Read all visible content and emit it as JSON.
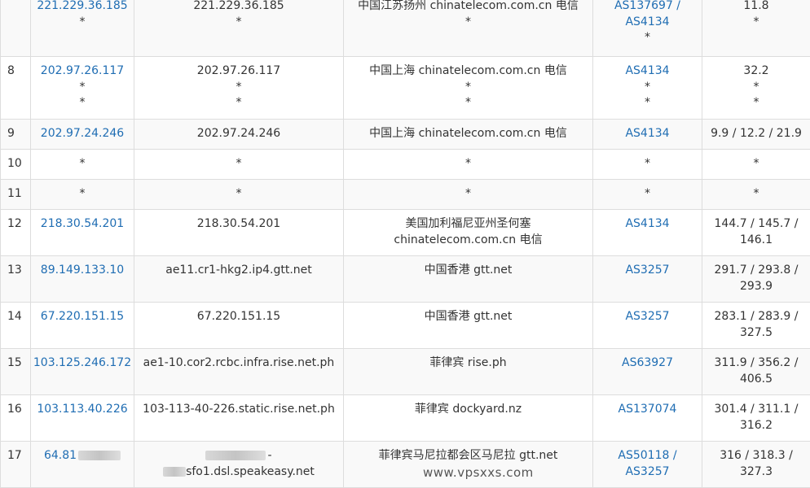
{
  "rows": [
    {
      "hop": "",
      "ip": [
        "221.229.36.185",
        "*"
      ],
      "host": [
        "221.229.36.185",
        "*"
      ],
      "loc": [
        "中国江苏扬州 chinatelecom.com.cn 电信",
        "*"
      ],
      "asn": [
        "AS137697 /",
        "AS4134",
        "*"
      ],
      "time": [
        "11.8",
        "*"
      ]
    },
    {
      "hop": "8",
      "ip": [
        "202.97.26.117",
        "*",
        "*"
      ],
      "host": [
        "202.97.26.117",
        "*",
        "*"
      ],
      "loc": [
        "中国上海 chinatelecom.com.cn 电信",
        "*",
        "*"
      ],
      "asn": [
        "AS4134",
        "*",
        "*"
      ],
      "time": [
        "32.2",
        "*",
        "*"
      ]
    },
    {
      "hop": "9",
      "ip": [
        "202.97.24.246"
      ],
      "host": [
        "202.97.24.246"
      ],
      "loc": [
        "中国上海 chinatelecom.com.cn 电信"
      ],
      "asn": [
        "AS4134"
      ],
      "time": [
        "9.9 / 12.2 / 21.9"
      ]
    },
    {
      "hop": "10",
      "ip": [
        "*"
      ],
      "host": [
        "*"
      ],
      "loc": [
        "*"
      ],
      "asn": [
        "*"
      ],
      "time": [
        "*"
      ]
    },
    {
      "hop": "11",
      "ip": [
        "*"
      ],
      "host": [
        "*"
      ],
      "loc": [
        "*"
      ],
      "asn": [
        "*"
      ],
      "time": [
        "*"
      ]
    },
    {
      "hop": "12",
      "ip": [
        "218.30.54.201"
      ],
      "host": [
        "218.30.54.201"
      ],
      "loc": [
        "美国加利福尼亚州圣何塞",
        "chinatelecom.com.cn 电信"
      ],
      "asn": [
        "AS4134"
      ],
      "time": [
        "144.7 / 145.7 /",
        "146.1"
      ]
    },
    {
      "hop": "13",
      "ip": [
        "89.149.133.10"
      ],
      "host": [
        "ae11.cr1-hkg2.ip4.gtt.net"
      ],
      "loc": [
        "中国香港 gtt.net"
      ],
      "asn": [
        "AS3257"
      ],
      "time": [
        "291.7 / 293.8 /",
        "293.9"
      ]
    },
    {
      "hop": "14",
      "ip": [
        "67.220.151.15"
      ],
      "host": [
        "67.220.151.15"
      ],
      "loc": [
        "中国香港 gtt.net"
      ],
      "asn": [
        "AS3257"
      ],
      "time": [
        "283.1 / 283.9 /",
        "327.5"
      ]
    },
    {
      "hop": "15",
      "ip": [
        "103.125.246.172"
      ],
      "host": [
        "ae1-10.cor2.rcbc.infra.rise.net.ph"
      ],
      "loc": [
        "菲律宾 rise.ph"
      ],
      "asn": [
        "AS63927"
      ],
      "time": [
        "311.9 / 356.2 /",
        "406.5"
      ]
    },
    {
      "hop": "16",
      "ip": [
        "103.113.40.226"
      ],
      "host": [
        "103-113-40-226.static.rise.net.ph"
      ],
      "loc": [
        "菲律宾 dockyard.nz"
      ],
      "asn": [
        "AS137074"
      ],
      "time": [
        "301.4 / 311.1 /",
        "316.2"
      ]
    },
    {
      "hop": "17",
      "ip": [
        "64.81"
      ],
      "host": [
        "-",
        "sfo1.dsl.speakeasy.net"
      ],
      "loc": [
        "菲律宾马尼拉都会区马尼拉 gtt.net"
      ],
      "asn": [
        "AS50118 /",
        "AS3257"
      ],
      "time": [
        "316 / 318.3 /",
        "327.3"
      ]
    }
  ],
  "watermark": "www.vpsxxs.com"
}
